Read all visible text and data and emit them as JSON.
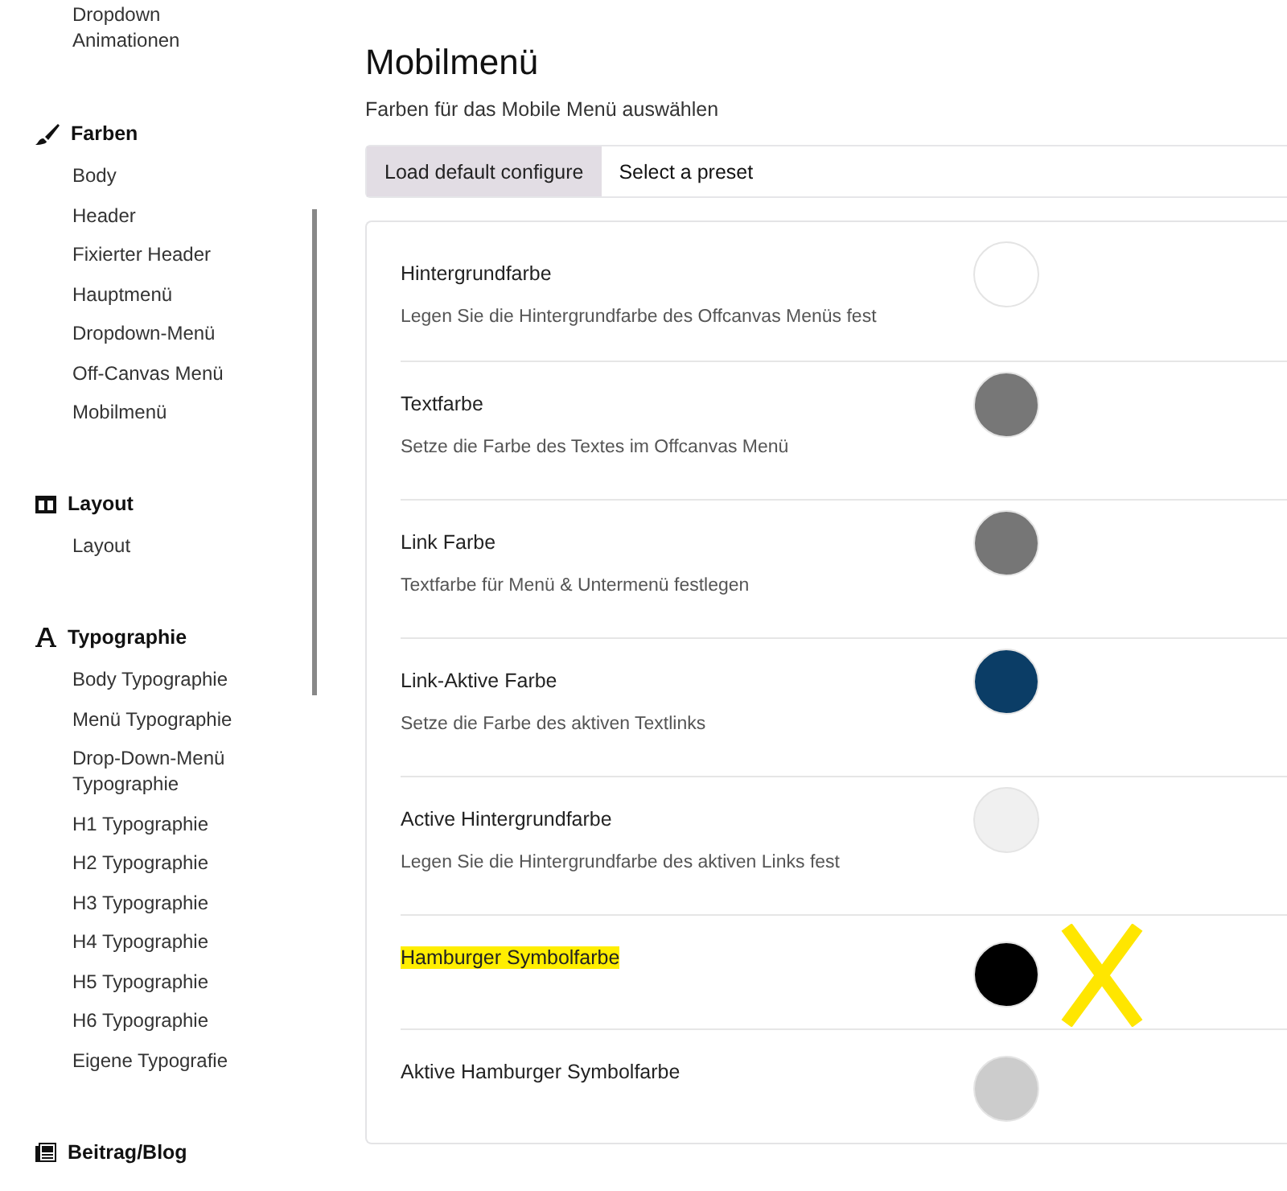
{
  "sidebar": {
    "top_item": "Dropdown Animationen",
    "sections": [
      {
        "title": "Farben",
        "items": [
          "Body",
          "Header",
          "Fixierter Header",
          "Hauptmenü",
          "Dropdown-Menü",
          "Off-Canvas Menü",
          "Mobilmenü"
        ]
      },
      {
        "title": "Layout",
        "items": [
          "Layout"
        ]
      },
      {
        "title": "Typographie",
        "items": [
          "Body Typographie",
          "Menü Typographie",
          "Drop-Down-Menü Typographie",
          "H1 Typographie",
          "H2 Typographie",
          "H3 Typographie",
          "H4 Typographie",
          "H5 Typographie",
          "H6 Typographie",
          "Eigene Typografie"
        ]
      },
      {
        "title": "Beitrag/Blog"
      }
    ]
  },
  "page": {
    "title": "Mobilmenü",
    "subtitle": "Farben für das Mobile Menü auswählen"
  },
  "toolbar": {
    "button": "Load default configure",
    "preset": "Select a preset"
  },
  "settings": [
    {
      "label": "Hintergrundfarbe",
      "description": "Legen Sie die Hintergrundfarbe des Offcanvas Menüs fest",
      "color": "#ffffff",
      "highlighted": false,
      "marked": false
    },
    {
      "label": "Textfarbe",
      "description": "Setze die Farbe des Textes im Offcanvas Menü",
      "color": "#777777",
      "highlighted": false,
      "marked": false
    },
    {
      "label": "Link Farbe",
      "description": "Textfarbe für Menü & Untermenü festlegen",
      "color": "#767676",
      "highlighted": false,
      "marked": false
    },
    {
      "label": "Link-Aktive Farbe",
      "description": "Setze die Farbe des aktiven Textlinks",
      "color": "#0b3d66",
      "highlighted": false,
      "marked": false
    },
    {
      "label": "Active Hintergrundfarbe",
      "description": "Legen Sie die Hintergrundfarbe des aktiven Links fest",
      "color": "#f0f0f0",
      "highlighted": false,
      "marked": false
    },
    {
      "label": "Hamburger Symbolfarbe",
      "color": "#000000",
      "highlighted": true,
      "marked": true
    },
    {
      "label": "Aktive Hamburger Symbolfarbe",
      "color": "#cccccc",
      "highlighted": false,
      "marked": false
    }
  ]
}
